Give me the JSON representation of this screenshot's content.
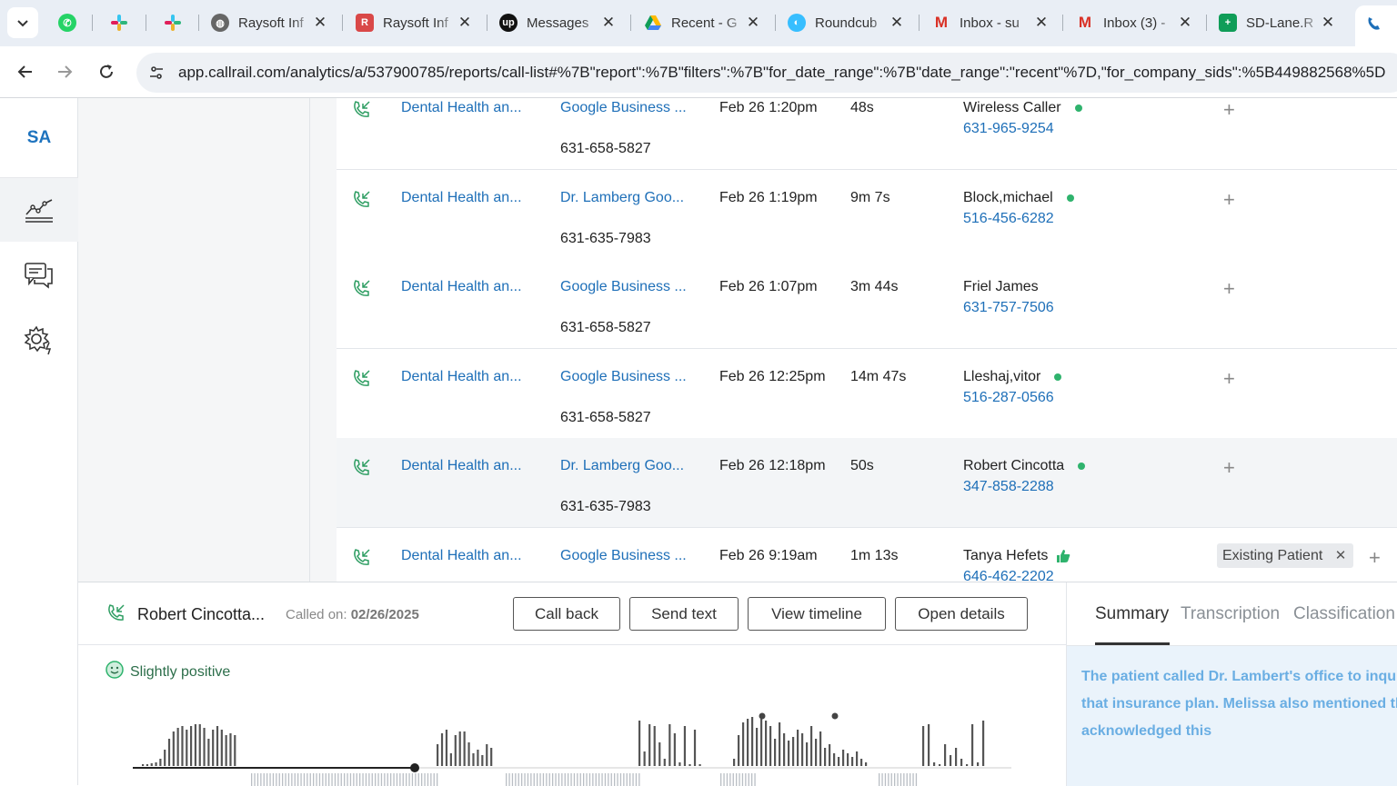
{
  "browser": {
    "tabs": [
      {
        "label": "",
        "icon": "whatsapp-icon"
      },
      {
        "label": "",
        "icon": "slack-icon"
      },
      {
        "label": "",
        "icon": "slack-icon"
      },
      {
        "label": "Raysoft Inf",
        "icon": "globe-icon"
      },
      {
        "label": "Raysoft Inf",
        "icon": "raysoft-icon"
      },
      {
        "label": "Messages",
        "icon": "upwork-icon"
      },
      {
        "label": "Recent - G",
        "icon": "google-drive-icon"
      },
      {
        "label": "Roundcub",
        "icon": "roundcube-icon"
      },
      {
        "label": "Inbox - su",
        "icon": "gmail-icon"
      },
      {
        "label": "Inbox (3) -",
        "icon": "gmail-icon"
      },
      {
        "label": "SD-Lane.R",
        "icon": "google-sheets-icon"
      }
    ],
    "url": "app.callrail.com/analytics/a/537900785/reports/call-list#%7B\"report\":%7B\"filters\":%7B\"for_date_range\":%7B\"date_range\":\"recent\"%7D,\"for_company_sids\":%5B449882568%5D"
  },
  "app": {
    "account_initials": "SA",
    "nav": [
      "analytics-icon",
      "messages-icon",
      "settings-icon"
    ]
  },
  "calls": [
    {
      "company": "Dental Health an...",
      "source": "Google Business ...",
      "tracking": "631-658-5827",
      "datetime": "Feb 26 1:20pm",
      "duration": "48s",
      "caller": "Wireless Caller",
      "caller_phone": "631-965-9254",
      "indicator": "dot"
    },
    {
      "company": "Dental Health an...",
      "source": "Dr. Lamberg Goo...",
      "tracking": "631-635-7983",
      "datetime": "Feb 26 1:19pm",
      "duration": "9m 7s",
      "caller": "Block,michael",
      "caller_phone": "516-456-6282",
      "indicator": "dot"
    },
    {
      "company": "Dental Health an...",
      "source": "Google Business ...",
      "tracking": "631-658-5827",
      "datetime": "Feb 26 1:07pm",
      "duration": "3m 44s",
      "caller": "Friel James",
      "caller_phone": "631-757-7506",
      "indicator": ""
    },
    {
      "company": "Dental Health an...",
      "source": "Google Business ...",
      "tracking": "631-658-5827",
      "datetime": "Feb 26 12:25pm",
      "duration": "14m 47s",
      "caller": "Lleshaj,vitor",
      "caller_phone": "516-287-0566",
      "indicator": "dot"
    },
    {
      "company": "Dental Health an...",
      "source": "Dr. Lamberg Goo...",
      "tracking": "631-635-7983",
      "datetime": "Feb 26 12:18pm",
      "duration": "50s",
      "caller": "Robert Cincotta",
      "caller_phone": "347-858-2288",
      "indicator": "dot"
    },
    {
      "company": "Dental Health an...",
      "source": "Google Business ...",
      "tracking": "",
      "datetime": "Feb 26 9:19am",
      "duration": "1m 13s",
      "caller": "Tanya Hefets",
      "caller_phone": "646-462-2202",
      "indicator": "thumbs-up",
      "tag": "Existing Patient"
    }
  ],
  "detail": {
    "caller": "Robert Cincotta...",
    "called_on_label": "Called on:",
    "called_on_date": "02/26/2025",
    "buttons": {
      "call_back": "Call back",
      "send_text": "Send text",
      "view_timeline": "View timeline",
      "open_details": "Open details"
    },
    "sentiment": "Slightly positive",
    "tabs": {
      "summary": "Summary",
      "transcription": "Transcription",
      "classification": "Classification"
    },
    "summary_text": "The patient called Dr. Lambert's office to inqui receptionist, Melissa, informed the patient that insurance plan. Melissa also mentioned that th from the office. The patient acknowledged this"
  },
  "colors": {
    "accent": "#1e6fb8",
    "positive": "#2fb36d",
    "summary_text": "#6aaee3"
  }
}
